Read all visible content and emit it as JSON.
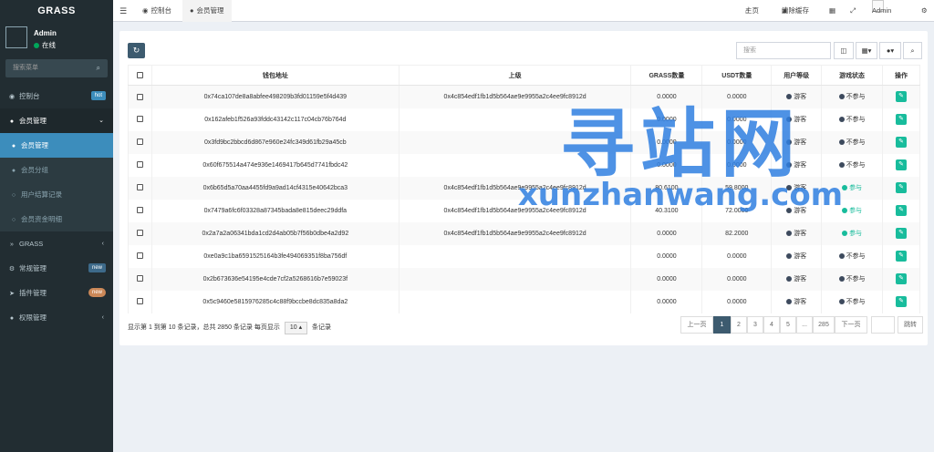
{
  "app": {
    "brand": "GRASS"
  },
  "user": {
    "name": "Admin",
    "status": "在线"
  },
  "sidebar": {
    "search_placeholder": "搜索菜单",
    "items": [
      {
        "label": "控制台",
        "badge": "hot"
      },
      {
        "label": "会员管理"
      },
      {
        "label": "会员管理"
      },
      {
        "label": "会员分组"
      },
      {
        "label": "用户结算记录"
      },
      {
        "label": "会员资金明细"
      },
      {
        "label": "GRASS"
      },
      {
        "label": "常规管理",
        "badge": "new"
      },
      {
        "label": "插件管理",
        "badge": "new"
      },
      {
        "label": "权限管理"
      }
    ]
  },
  "topbar": {
    "tabs": [
      "控制台",
      "会员管理"
    ],
    "home": "主页",
    "clear_cache": "清除缓存",
    "admin": "Admin"
  },
  "toolbar": {
    "search_placeholder": "搜索"
  },
  "table": {
    "headers": [
      "钱包地址",
      "上级",
      "GRASS数量",
      "USDT数量",
      "用户等级",
      "游戏状态",
      "操作"
    ],
    "rows": [
      {
        "wallet": "0x74ca107de8a8abfee498209b3fd01159e5f4d439",
        "parent": "0x4c854edf1fb1d5b564ae9e9955a2c4ee9fc8912d",
        "grass": "0.0000",
        "usdt": "0.0000",
        "level": "游客",
        "status": "不参与"
      },
      {
        "wallet": "0x162afeb1f526a93fddc43142c117c04cb76b764d",
        "parent": "",
        "grass": "0.0000",
        "usdt": "0.0000",
        "level": "游客",
        "status": "不参与"
      },
      {
        "wallet": "0x3fd9bc2bbcd6d867e960e24fc349d61fb29a45cb",
        "parent": "",
        "grass": "0.0000",
        "usdt": "0.0000",
        "level": "游客",
        "status": "不参与"
      },
      {
        "wallet": "0x60f675514a474e936e1469417b645d7741fbdc42",
        "parent": "",
        "grass": "0.0000",
        "usdt": "0.0000",
        "level": "游客",
        "status": "不参与"
      },
      {
        "wallet": "0x6b65d5a70aa4455fd9a9ad14cf4315e40642bca3",
        "parent": "0x4c854edf1fb1d5b564ae9e9955a2c4ee9fc8912d",
        "grass": "80.6100",
        "usdt": "59.8000",
        "level": "游客",
        "status": "参与"
      },
      {
        "wallet": "0x7479a6fc6f03328a87345bada8e815deec29ddfa",
        "parent": "0x4c854edf1fb1d5b564ae9e9955a2c4ee9fc8912d",
        "grass": "40.3100",
        "usdt": "72.0000",
        "level": "游客",
        "status": "参与"
      },
      {
        "wallet": "0x2a7a2a06341bda1cd2d4ab05b7f56b0dbe4a2d92",
        "parent": "0x4c854edf1fb1d5b564ae9e9955a2c4ee9fc8912d",
        "grass": "0.0000",
        "usdt": "82.2000",
        "level": "游客",
        "status": "参与"
      },
      {
        "wallet": "0xe0a9c1ba6591525164b3fe494069351f8ba756df",
        "parent": "",
        "grass": "0.0000",
        "usdt": "0.0000",
        "level": "游客",
        "status": "不参与"
      },
      {
        "wallet": "0x2b673636e54195e4cde7cf2a5268616b7e59023f",
        "parent": "",
        "grass": "0.0000",
        "usdt": "0.0000",
        "level": "游客",
        "status": "不参与"
      },
      {
        "wallet": "0x5c9460e5815976285c4c88f9bccbe8dc835a8da2",
        "parent": "",
        "grass": "0.0000",
        "usdt": "0.0000",
        "level": "游客",
        "status": "不参与"
      }
    ]
  },
  "pagination": {
    "info_prefix": "显示第 1 到第 10 条记录，总共 2850 条记录 每页显示",
    "page_size": "10",
    "info_suffix": "条记录",
    "prev": "上一页",
    "pages": [
      "1",
      "2",
      "3",
      "4",
      "5",
      "...",
      "285"
    ],
    "next": "下一页",
    "jump": "跳转"
  },
  "watermark": {
    "cn": "寻站网",
    "en": "xunzhanwang.com"
  },
  "colors": {
    "sidebar": "#222d32",
    "active": "#3c8dbc",
    "primary": "#3d5b6f",
    "success": "#18bc9c"
  }
}
